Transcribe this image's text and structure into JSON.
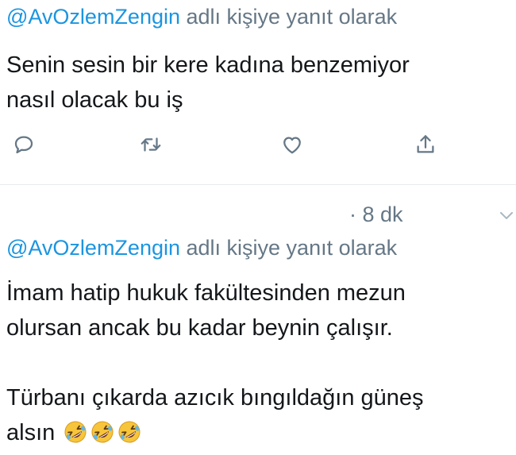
{
  "tweets": [
    {
      "mention": "@AvOzlemZengin",
      "reply_suffix": " adlı kişiye yanıt olarak",
      "text": "Senin sesin bir kere kadına benzemiyor\nnasıl olacak bu iş",
      "actions": [
        "reply-icon",
        "retweet-icon",
        "like-icon",
        "share-icon"
      ]
    },
    {
      "time": "· 8 dk",
      "mention": "@AvOzlemZengin",
      "reply_suffix": " adlı kişiye yanıt olarak",
      "text_line_1": "İmam hatip hukuk fakültesinden mezun",
      "text_line_2": "olursan ancak bu kadar beynin çalışır.",
      "text_line_3": "Türbanı çıkarda azıcık bıngıldağın güneş",
      "text_line_4": "alsın",
      "emoji_count": 3,
      "emoji_name": "rolling-on-the-floor-laughing-emoji"
    }
  ],
  "colors": {
    "mention": "#1b95e0",
    "secondary_text": "#657786",
    "primary_text": "#14171a",
    "icon": "#657786",
    "emoji_face": "#f7c53b",
    "divider": "#e6ecf0"
  }
}
